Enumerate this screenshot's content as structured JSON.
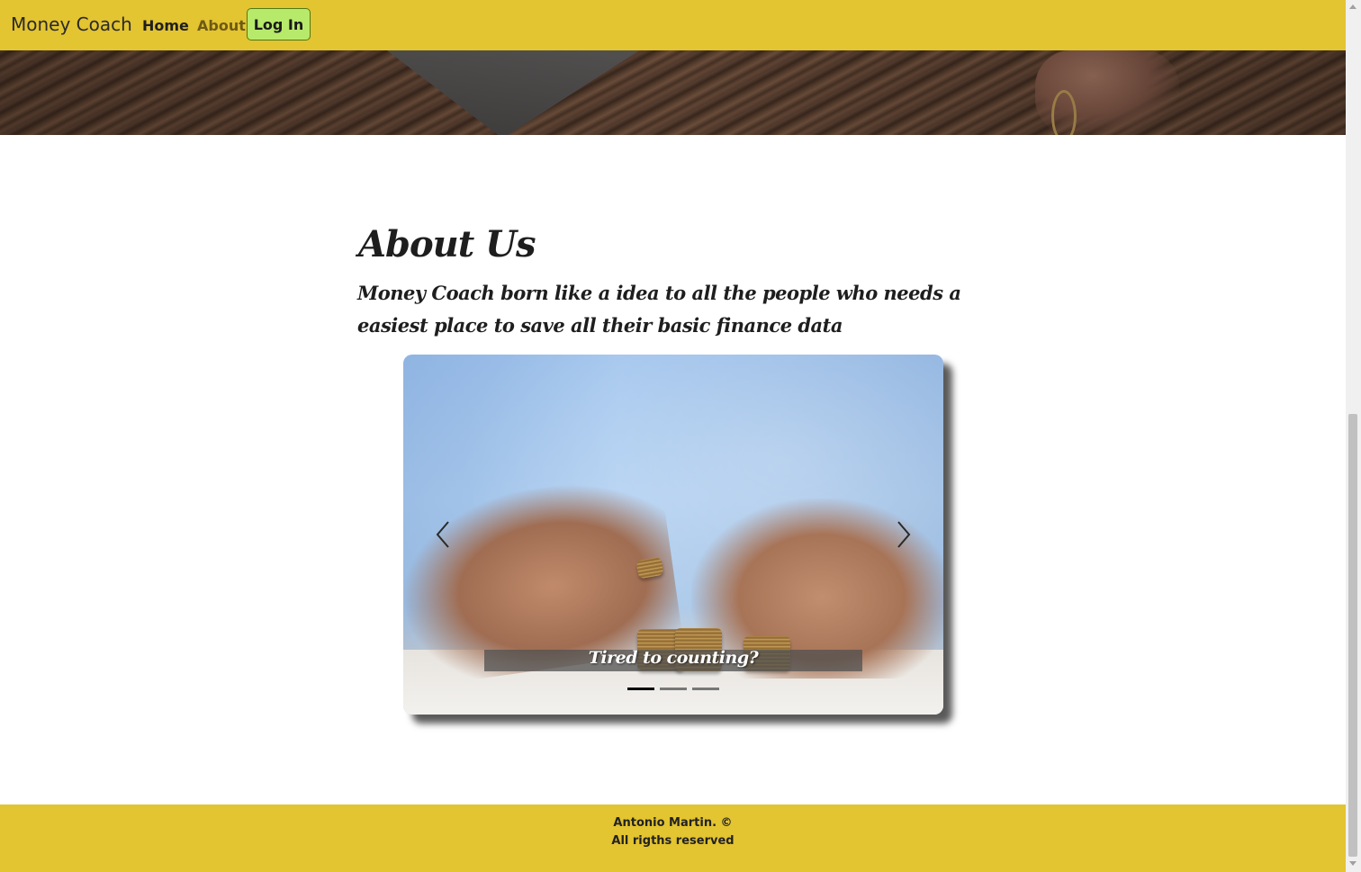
{
  "navbar": {
    "brand": "Money Coach",
    "links": [
      {
        "label": "Home"
      },
      {
        "label": "About"
      }
    ],
    "login_label": "Log In",
    "background_color": "#e3c431",
    "login_button_color": "#b7ea6b"
  },
  "about": {
    "title": "About Us",
    "description": "Money Coach born like a idea to all the people who needs a easiest place to save all their basic finance data"
  },
  "carousel": {
    "caption": "Tired to counting?",
    "slide_count": 3,
    "active_slide": 1,
    "prev_icon": "chevron-left-icon",
    "next_icon": "chevron-right-icon"
  },
  "footer": {
    "line1": "Antonio Martin. ©",
    "line2": "All rigths reserved",
    "background_color": "#e3c431"
  }
}
